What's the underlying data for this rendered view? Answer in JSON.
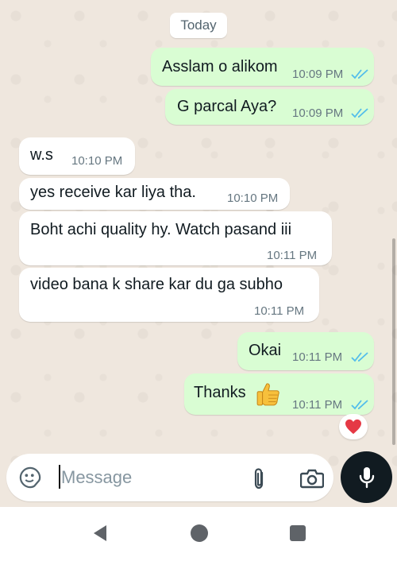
{
  "date_divider": "Today",
  "messages": [
    {
      "text": "Asslam o alikom",
      "time": "10:09 PM",
      "direction": "out",
      "status": "read"
    },
    {
      "text": "G parcal Aya?",
      "time": "10:09 PM",
      "direction": "out",
      "status": "read"
    },
    {
      "text": "w.s",
      "time": "10:10 PM",
      "direction": "in"
    },
    {
      "text": "yes receive kar liya tha.",
      "time": "10:10 PM",
      "direction": "in"
    },
    {
      "text": "Boht achi quality hy. Watch pasand iii",
      "time": "10:11 PM",
      "direction": "in"
    },
    {
      "text": "video bana k share kar du ga subho",
      "time": "10:11 PM",
      "direction": "in"
    },
    {
      "text": "Okai",
      "time": "10:11 PM",
      "direction": "out",
      "status": "read"
    },
    {
      "text": "Thanks",
      "emoji": "thumbs-up",
      "time": "10:11 PM",
      "direction": "out",
      "status": "read",
      "reaction": "red-heart"
    }
  ],
  "composer": {
    "placeholder": "Message",
    "icons": [
      "sticker-icon",
      "attach-icon",
      "camera-icon",
      "mic-icon"
    ]
  },
  "navigation": [
    "back-icon",
    "home-icon",
    "recents-icon"
  ],
  "colors": {
    "outgoing_bubble": "#d9fdd3",
    "incoming_bubble": "#ffffff",
    "read_ticks": "#53bdeb",
    "background": "#efe7de",
    "mic_button": "#111b21"
  }
}
